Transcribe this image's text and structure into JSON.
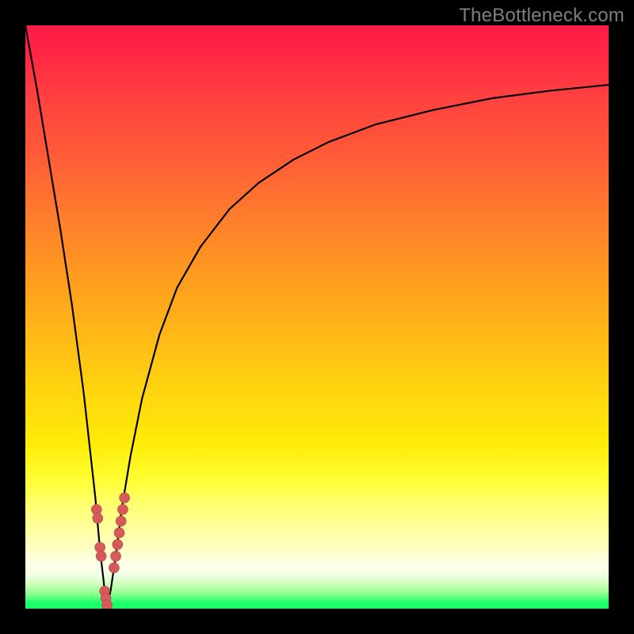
{
  "watermark": "TheBottleneck.com",
  "colors": {
    "frame": "#000000",
    "curve": "#000000",
    "marker_fill": "#d65a5a",
    "marker_stroke": "#b84848",
    "watermark_text": "#7f7f7f"
  },
  "chart_data": {
    "type": "line",
    "title": "",
    "xlabel": "",
    "ylabel": "",
    "xlim": [
      0,
      100
    ],
    "ylim": [
      0,
      100
    ],
    "grid": false,
    "series": [
      {
        "name": "bottleneck-curve",
        "x": [
          0,
          2,
          4,
          6,
          8,
          10,
          11,
          12,
          12.8,
          13.5,
          14,
          14.6,
          15.5,
          16.5,
          18,
          20,
          23,
          26,
          30,
          35,
          40,
          46,
          52,
          60,
          70,
          80,
          90,
          100
        ],
        "y": [
          100,
          89,
          77,
          65,
          52,
          37,
          28,
          19,
          10,
          4,
          0.5,
          3,
          9,
          17,
          26,
          36,
          47,
          55,
          62,
          68.5,
          73,
          77,
          80,
          83,
          85.5,
          87.5,
          88.8,
          89.8
        ]
      }
    ],
    "markers": [
      {
        "x": 12.2,
        "y": 17
      },
      {
        "x": 12.4,
        "y": 15.5
      },
      {
        "x": 12.8,
        "y": 10.5
      },
      {
        "x": 13.0,
        "y": 9
      },
      {
        "x": 13.6,
        "y": 3
      },
      {
        "x": 13.8,
        "y": 1.8
      },
      {
        "x": 14.0,
        "y": 0.6
      },
      {
        "x": 15.2,
        "y": 7
      },
      {
        "x": 15.5,
        "y": 9
      },
      {
        "x": 15.8,
        "y": 11
      },
      {
        "x": 16.1,
        "y": 13
      },
      {
        "x": 16.4,
        "y": 15
      },
      {
        "x": 16.7,
        "y": 17
      },
      {
        "x": 17.0,
        "y": 19
      }
    ]
  }
}
